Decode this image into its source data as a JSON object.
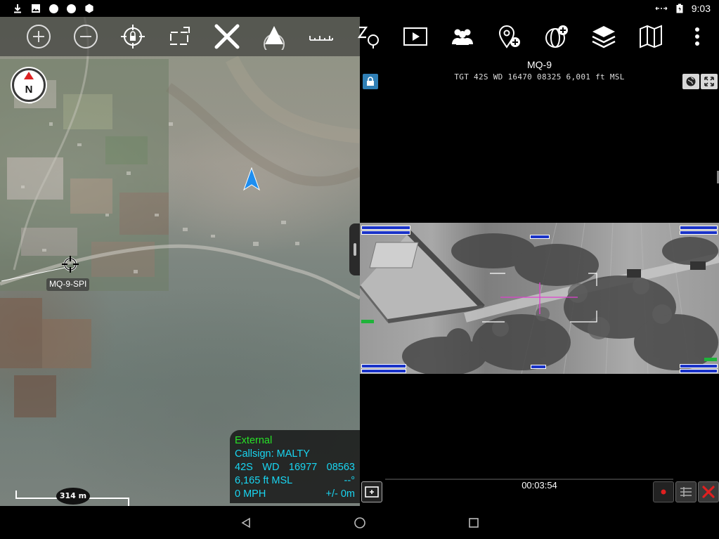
{
  "status_bar": {
    "time": "9:03",
    "left_icons": [
      "download-icon",
      "image-icon",
      "circle-icon",
      "circle-icon",
      "settings-icon"
    ],
    "right_icons": [
      "signal-arrows-icon",
      "battery-icon"
    ]
  },
  "toolbar": {
    "items": [
      {
        "name": "zoom-in-icon"
      },
      {
        "name": "zoom-out-icon"
      },
      {
        "name": "lock-location-icon"
      },
      {
        "name": "rotate-icon"
      },
      {
        "name": "x-logo-icon"
      },
      {
        "name": "cone-icon"
      },
      {
        "name": "ruler-icon"
      },
      {
        "name": "route-icon"
      },
      {
        "name": "video-play-icon"
      },
      {
        "name": "contacts-icon"
      },
      {
        "name": "add-point-icon"
      },
      {
        "name": "add-globe-icon"
      },
      {
        "name": "layers-icon"
      },
      {
        "name": "map-icon"
      },
      {
        "name": "more-vertical-icon"
      }
    ]
  },
  "map": {
    "compass_label": "N",
    "spi_label": "MQ-9-SPI",
    "scale_label": "314 m"
  },
  "info_panel": {
    "status": "External",
    "callsign": "Callsign: MALTY",
    "grid": "42S",
    "grid_sq": "WD",
    "easting": "16977",
    "northing": "08563",
    "altitude": "6,165 ft MSL",
    "heading": "--°",
    "speed": "0 MPH",
    "accuracy": "+/- 0m"
  },
  "video": {
    "title": "MQ-9",
    "target": "TGT 42S WD 16470 08325  6,001 ft MSL",
    "timecode": "00:03:54"
  },
  "colors": {
    "info_text": "#19d6f2",
    "external_text": "#27e227",
    "hud_box": "#1a33c8",
    "lock_button": "#2f7fb5",
    "close_button": "#e02020",
    "reticle": "#e040d0"
  }
}
